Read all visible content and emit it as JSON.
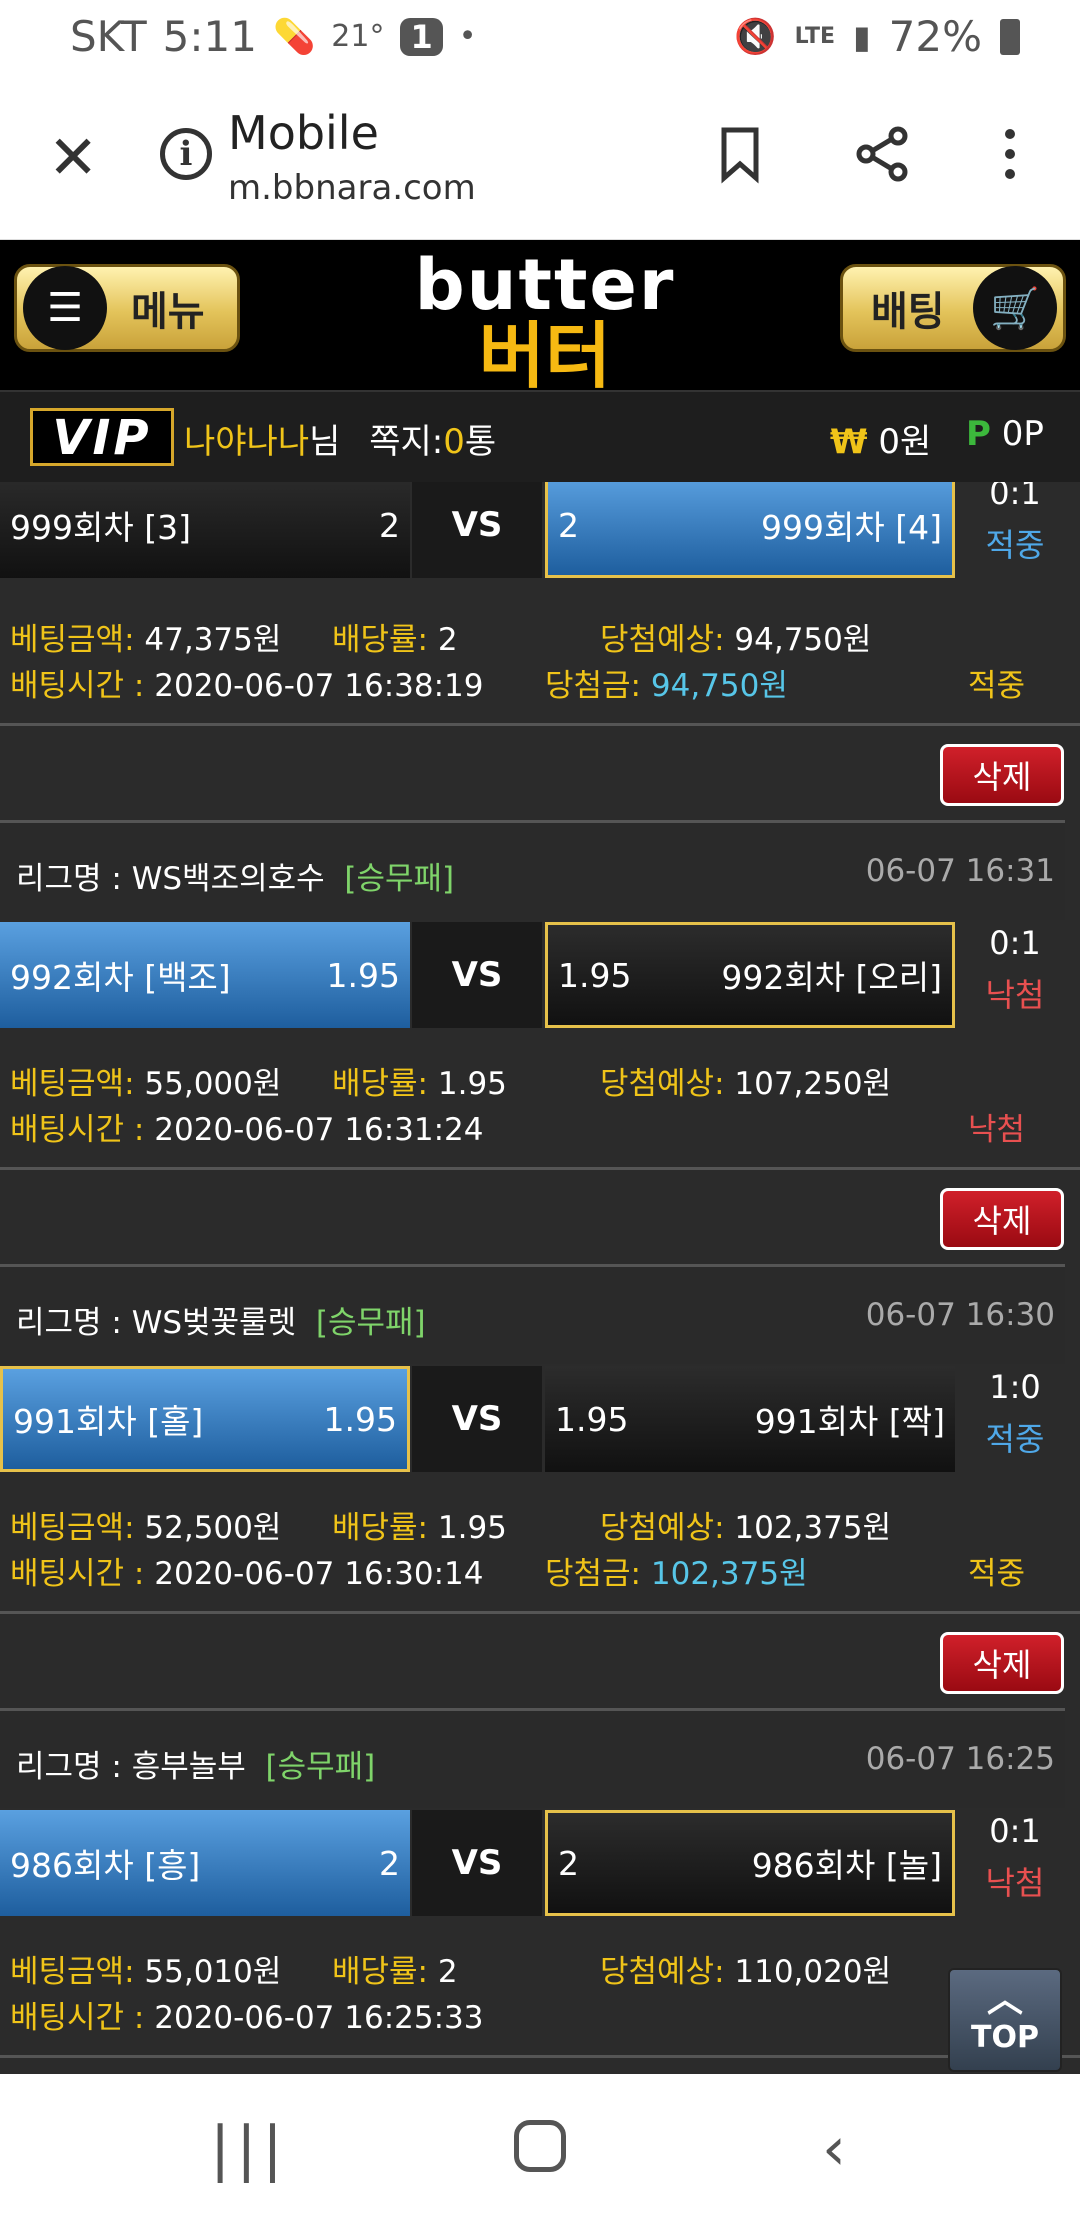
{
  "status": {
    "carrier": "SKT",
    "time": "5:11",
    "temp": "21°",
    "notif": "1",
    "dot": "•",
    "lte": "LTE",
    "battery": "72%"
  },
  "browser": {
    "title": "Mobile",
    "url": "m.bbnara.com"
  },
  "header": {
    "menu_label": "메뉴",
    "bet_label": "배팅",
    "logo_en": "butter",
    "logo_ko": "버터"
  },
  "user": {
    "vip": "VIP",
    "nickname": "나야나나",
    "suffix": "님",
    "msg_label": "쪽지:",
    "msg_count": "0",
    "msg_unit": "통",
    "won_sym": "₩",
    "won": "0원",
    "p_sym": "P",
    "points": "0P"
  },
  "labels": {
    "vs": "VS",
    "bet_amount": "베팅금액:",
    "odds": "배당률:",
    "expected": "당첨예상:",
    "bet_time": "배팅시간 :",
    "prize": "당첨금:",
    "delete": "삭제",
    "league": "리그명 :",
    "top": "TOP"
  },
  "bets": [
    {
      "home": "999회차 [3]",
      "home_odds": "2",
      "away_odds": "2",
      "away": "999회차 [4]",
      "score": "0:1",
      "result": "적중",
      "amount": "47,375원",
      "odds": "2",
      "expected": "94,750원",
      "time": "2020-06-07 16:38:19",
      "prize": "94,750원",
      "status": "적중"
    },
    {
      "league": "WS백조의호수",
      "tag": "[승무패]",
      "date": "06-07 16:31",
      "home": "992회차 [백조]",
      "home_odds": "1.95",
      "away_odds": "1.95",
      "away": "992회차 [오리]",
      "score": "0:1",
      "result": "낙첨",
      "amount": "55,000원",
      "odds": "1.95",
      "expected": "107,250원",
      "time": "2020-06-07 16:31:24",
      "status": "낙첨"
    },
    {
      "league": "WS벚꽃룰렛",
      "tag": "[승무패]",
      "date": "06-07 16:30",
      "home": "991회차 [홀]",
      "home_odds": "1.95",
      "away_odds": "1.95",
      "away": "991회차 [짝]",
      "score": "1:0",
      "result": "적중",
      "amount": "52,500원",
      "odds": "1.95",
      "expected": "102,375원",
      "time": "2020-06-07 16:30:14",
      "prize": "102,375원",
      "status": "적중"
    },
    {
      "league": "흥부놀부",
      "tag": "[승무패]",
      "date": "06-07 16:25",
      "home": "986회차 [흥]",
      "home_odds": "2",
      "away_odds": "2",
      "away": "986회차 [놀]",
      "score": "0:1",
      "result": "낙첨",
      "amount": "55,010원",
      "odds": "2",
      "expected": "110,020원",
      "time": "2020-06-07 16:25:33"
    }
  ]
}
